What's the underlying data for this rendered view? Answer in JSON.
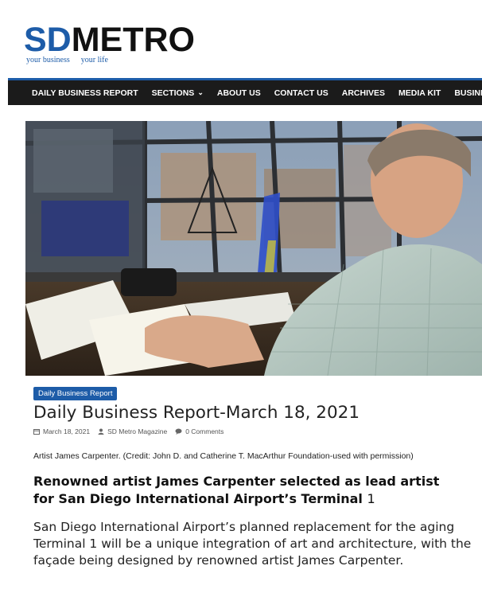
{
  "header": {
    "logo_part1": "SD",
    "logo_part2": "METRO",
    "tagline_1": "your business",
    "tagline_2": "your life"
  },
  "nav": {
    "items": [
      {
        "label": "DAILY BUSINESS REPORT"
      },
      {
        "label": "SECTIONS"
      },
      {
        "label": "ABOUT US"
      },
      {
        "label": "CONTACT US"
      },
      {
        "label": "ARCHIVES"
      },
      {
        "label": "MEDIA KIT"
      },
      {
        "label": "BUSINESS DIREC"
      }
    ]
  },
  "article": {
    "category": "Daily Business Report",
    "title": "Daily Business Report-March 18, 2021",
    "date": "March 18, 2021",
    "author": "SD Metro Magazine",
    "comments": "0 Comments",
    "caption": "Artist James Carpenter. (Credit: John D. and Catherine T. MacArthur Foundation-used with permission)",
    "headline_line1": "Renowned artist James Carpenter selected as lead artist",
    "headline_line2": "for San Diego International Airport’s Terminal",
    "headline_num": "1",
    "body": "San Diego International Airport’s planned replacement for the aging Terminal 1 will be a unique integration of art and architecture, with the façade being designed by renowned artist James Carpenter."
  },
  "colors": {
    "brand_blue": "#1d5ca8",
    "nav_bg": "#1b1b1b"
  }
}
